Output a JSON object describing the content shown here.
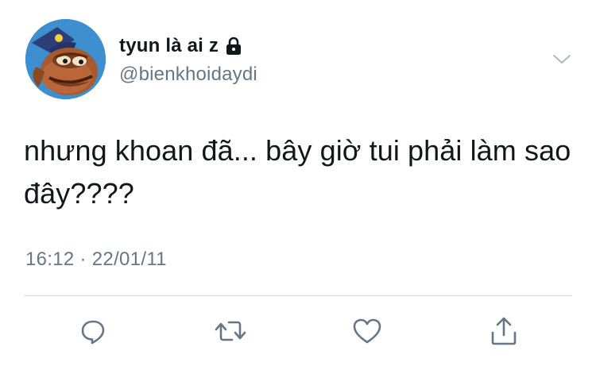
{
  "user": {
    "display_name": "tyun là ai z",
    "handle": "@bienkhoidaydi",
    "protected_icon": "lock-icon",
    "avatar": "cartoon-fish-avatar"
  },
  "tweet": {
    "text": "nhưng khoan đã... bây giờ tui phải làm sao đây????",
    "timestamp": "16:12 · 22/01/11"
  },
  "menu_icon": "chevron-down-icon",
  "actions": [
    {
      "name": "reply",
      "icon": "comment-icon"
    },
    {
      "name": "retweet",
      "icon": "retweet-icon"
    },
    {
      "name": "like",
      "icon": "heart-icon"
    },
    {
      "name": "share",
      "icon": "share-icon"
    }
  ],
  "colors": {
    "text_primary": "#14171a",
    "text_secondary": "#657786",
    "icon": "#657786",
    "divider": "#d6dce1",
    "background": "#ffffff"
  }
}
